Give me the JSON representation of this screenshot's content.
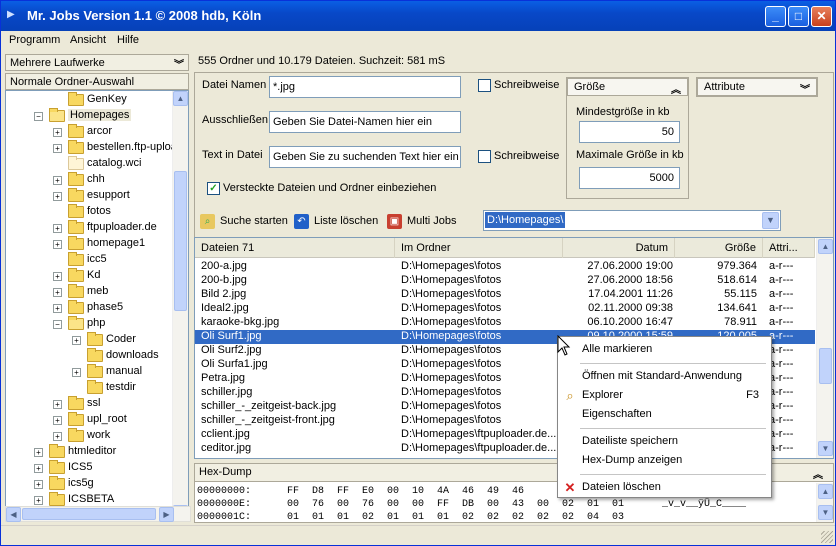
{
  "window": {
    "title": "Mr. Jobs  Version 1.1   ©  2008 hdb, Köln",
    "min": "_",
    "max": "□",
    "close": "✕"
  },
  "menu": [
    "Programm",
    "Ansicht",
    "Hilfe"
  ],
  "sidebar": {
    "drives_header": "Mehrere Laufwerke",
    "selection_header": "Normale Ordner-Auswahl",
    "tree": [
      {
        "label": "GenKey",
        "level": 1,
        "expander": "",
        "folder": "closed"
      },
      {
        "label": "Homepages",
        "level": 0,
        "expander": "−",
        "folder": "open",
        "selected": true
      },
      {
        "label": "arcor",
        "level": 1,
        "expander": "+",
        "folder": "closed"
      },
      {
        "label": "bestellen.ftp-uploa",
        "level": 1,
        "expander": "+",
        "folder": "closed"
      },
      {
        "label": "catalog.wci",
        "level": 1,
        "expander": "",
        "folder": "pale"
      },
      {
        "label": "chh",
        "level": 1,
        "expander": "+",
        "folder": "closed"
      },
      {
        "label": "esupport",
        "level": 1,
        "expander": "+",
        "folder": "closed"
      },
      {
        "label": "fotos",
        "level": 1,
        "expander": "",
        "folder": "closed"
      },
      {
        "label": "ftpuploader.de",
        "level": 1,
        "expander": "+",
        "folder": "closed"
      },
      {
        "label": "homepage1",
        "level": 1,
        "expander": "+",
        "folder": "closed"
      },
      {
        "label": "icc5",
        "level": 1,
        "expander": "",
        "folder": "closed"
      },
      {
        "label": "Kd",
        "level": 1,
        "expander": "+",
        "folder": "closed"
      },
      {
        "label": "meb",
        "level": 1,
        "expander": "+",
        "folder": "closed"
      },
      {
        "label": "phase5",
        "level": 1,
        "expander": "+",
        "folder": "closed"
      },
      {
        "label": "php",
        "level": 1,
        "expander": "−",
        "folder": "open"
      },
      {
        "label": "Coder",
        "level": 2,
        "expander": "+",
        "folder": "closed"
      },
      {
        "label": "downloads",
        "level": 2,
        "expander": "",
        "folder": "closed"
      },
      {
        "label": "manual",
        "level": 2,
        "expander": "+",
        "folder": "closed"
      },
      {
        "label": "testdir",
        "level": 2,
        "expander": "",
        "folder": "closed"
      },
      {
        "label": "ssl",
        "level": 1,
        "expander": "+",
        "folder": "closed"
      },
      {
        "label": "upl_root",
        "level": 1,
        "expander": "+",
        "folder": "closed"
      },
      {
        "label": "work",
        "level": 1,
        "expander": "+",
        "folder": "closed"
      },
      {
        "label": "htmleditor",
        "level": 0,
        "expander": "+",
        "folder": "closed"
      },
      {
        "label": "ICS5",
        "level": 0,
        "expander": "+",
        "folder": "closed"
      },
      {
        "label": "ics5g",
        "level": 0,
        "expander": "+",
        "folder": "closed"
      },
      {
        "label": "ICSBETA",
        "level": 0,
        "expander": "+",
        "folder": "closed"
      }
    ]
  },
  "status": "555 Ordner und 10.179 Dateien.  Suchzeit: 581 mS",
  "search": {
    "filename_label": "Datei Namen",
    "filename_value": "*.jpg",
    "exclude_label": "Ausschließen",
    "exclude_placeholder": "Geben Sie Datei-Namen hier ein",
    "text_label": "Text in Datei",
    "text_placeholder": "Geben Sie zu suchenden Text hier ein",
    "case1_label": "Schreibweise",
    "case2_label": "Schreibweise",
    "hidden_label": "Versteckte Dateien und Ordner einbeziehen",
    "hidden_checked": "✓"
  },
  "size_group": {
    "header": "Größe",
    "min_label": "Mindestgröße in kb",
    "min_value": "50",
    "max_label": "Maximale Größe in kb",
    "max_value": "5000"
  },
  "attributes_header": "Attribute",
  "toolbar": {
    "start": "Suche starten",
    "clear": "Liste löschen",
    "multi": "Multi Jobs",
    "path": "D:\\Homepages\\"
  },
  "list": {
    "headers": [
      "Dateien 71",
      "Im Ordner",
      "Datum",
      "Größe",
      "Attri..."
    ],
    "rows": [
      [
        "200-a.jpg",
        "D:\\Homepages\\fotos",
        "27.06.2000 19:00",
        "979.364",
        "a-r---"
      ],
      [
        "200-b.jpg",
        "D:\\Homepages\\fotos",
        "27.06.2000 18:56",
        "518.614",
        "a-r---"
      ],
      [
        "Bild 2.jpg",
        "D:\\Homepages\\fotos",
        "17.04.2001 11:26",
        "55.115",
        "a-r---"
      ],
      [
        "Ideal2.jpg",
        "D:\\Homepages\\fotos",
        "02.11.2000 09:38",
        "134.641",
        "a-r---"
      ],
      [
        "karaoke-bkg.jpg",
        "D:\\Homepages\\fotos",
        "06.10.2000 16:47",
        "78.911",
        "a-r---"
      ],
      [
        "Oli Surf1.jpg",
        "D:\\Homepages\\fotos",
        "09.10.2000 15:59",
        "120.005",
        "a-r---"
      ],
      [
        "Oli Surf2.jpg",
        "D:\\Homepages\\fotos",
        "",
        "",
        "a-r---"
      ],
      [
        "Oli Surfa1.jpg",
        "D:\\Homepages\\fotos",
        "",
        "",
        "a-r---"
      ],
      [
        "Petra.jpg",
        "D:\\Homepages\\fotos",
        "",
        "",
        "a-r---"
      ],
      [
        "schiller.jpg",
        "D:\\Homepages\\fotos",
        "",
        "",
        "a-r---"
      ],
      [
        "schiller_-_zeitgeist-back.jpg",
        "D:\\Homepages\\fotos",
        "",
        "",
        "a-r---"
      ],
      [
        "schiller_-_zeitgeist-front.jpg",
        "D:\\Homepages\\fotos",
        "",
        "",
        "a-r---"
      ],
      [
        "cclient.jpg",
        "D:\\Homepages\\ftpuploader.de...",
        "",
        "",
        "a-r---"
      ],
      [
        "ceditor.jpg",
        "D:\\Homepages\\ftpuploader.de...",
        "",
        "",
        "a-r---"
      ]
    ]
  },
  "hex": {
    "header": "Hex-Dump",
    "rows": [
      {
        "addr": "00000000:",
        "bytes": [
          "FF",
          "D8",
          "FF",
          "E0",
          "00",
          "10",
          "4A",
          "46",
          "49",
          "46"
        ],
        "ascii": ""
      },
      {
        "addr": "0000000E:",
        "bytes": [
          "00",
          "76",
          "00",
          "76",
          "00",
          "00",
          "FF",
          "DB",
          "00",
          "43",
          "00",
          "02",
          "01",
          "01"
        ],
        "ascii": "_v_v__ÿÛ_C____"
      },
      {
        "addr": "0000001C:",
        "bytes": [
          "01",
          "01",
          "01",
          "02",
          "01",
          "01",
          "01",
          "02",
          "02",
          "02",
          "02",
          "02",
          "04",
          "03"
        ],
        "ascii": ""
      }
    ]
  },
  "context_menu": {
    "items": [
      {
        "label": "Alle markieren",
        "icon": "",
        "shortcut": ""
      },
      {
        "sep": true
      },
      {
        "label": "Öffnen mit Standard-Anwendung",
        "icon": "",
        "shortcut": ""
      },
      {
        "label": "Explorer",
        "icon": "explorer-icon",
        "shortcut": "F3"
      },
      {
        "label": "Eigenschaften",
        "icon": "",
        "shortcut": ""
      },
      {
        "sep": true
      },
      {
        "label": "Dateiliste speichern",
        "icon": "",
        "shortcut": ""
      },
      {
        "label": "Hex-Dump anzeigen",
        "icon": "",
        "shortcut": ""
      },
      {
        "sep": true
      },
      {
        "label": "Dateien löschen",
        "icon": "delete-icon",
        "shortcut": ""
      }
    ]
  },
  "colors": {
    "titlebar": "#0848c8",
    "selection": "#316ac5",
    "folder": "#f8d860",
    "delete": "#d42020"
  }
}
